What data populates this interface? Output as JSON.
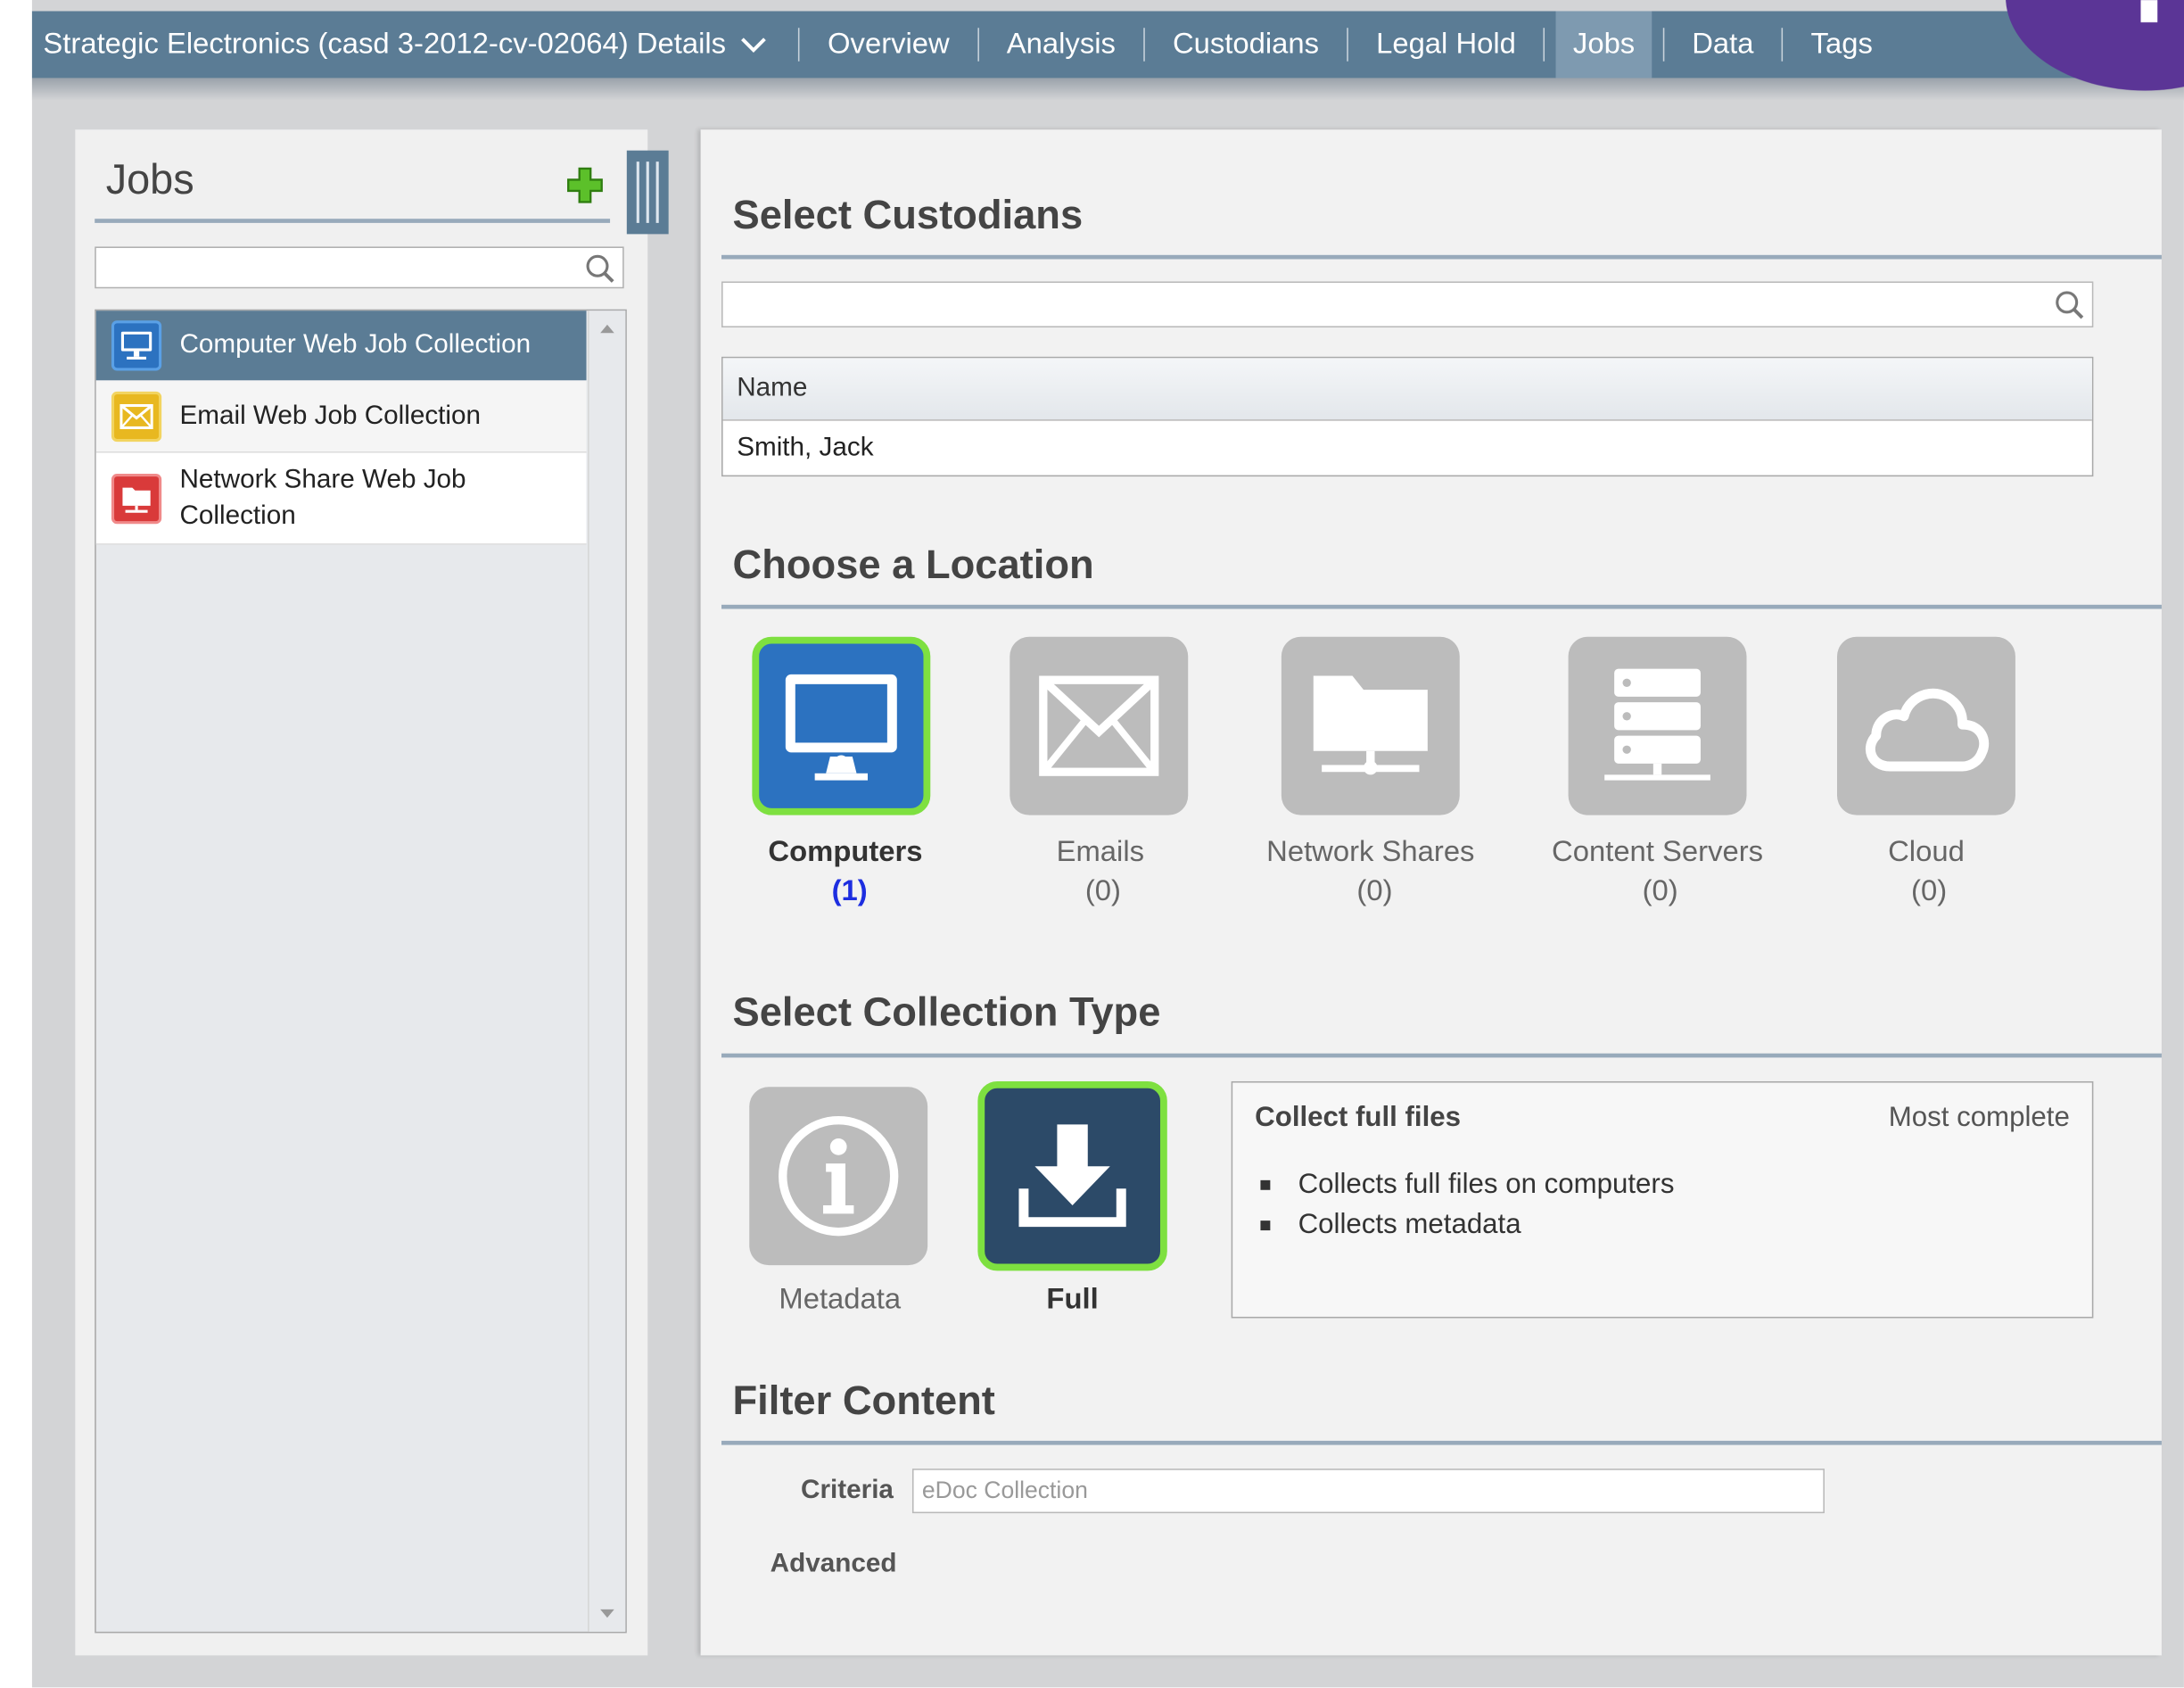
{
  "header": {
    "case_title": "Strategic Electronics (casd 3-2012-cv-02064) Details",
    "tabs": [
      {
        "label": "Overview"
      },
      {
        "label": "Analysis"
      },
      {
        "label": "Custodians"
      },
      {
        "label": "Legal Hold"
      },
      {
        "label": "Jobs",
        "active": true
      },
      {
        "label": "Data"
      },
      {
        "label": "Tags"
      }
    ]
  },
  "jobs_panel": {
    "title": "Jobs",
    "search_value": "",
    "items": [
      {
        "label": "Computer Web Job Collection",
        "icon": "computer-icon",
        "selected": true,
        "color": "#2c72c0"
      },
      {
        "label": "Email Web Job Collection",
        "icon": "envelope-icon",
        "color": "#e8b820"
      },
      {
        "label": "Network Share Web Job Collection",
        "icon": "network-share-icon",
        "color": "#d93a3a"
      }
    ]
  },
  "custodians": {
    "title": "Select Custodians",
    "search_value": "",
    "column_header": "Name",
    "rows": [
      {
        "name": "Smith, Jack"
      }
    ]
  },
  "location": {
    "title": "Choose a Location",
    "options": [
      {
        "label": "Computers",
        "count": "(1)",
        "icon": "monitor-icon",
        "selected": true
      },
      {
        "label": "Emails",
        "count": "(0)",
        "icon": "envelope-icon"
      },
      {
        "label": "Network Shares",
        "count": "(0)",
        "icon": "folder-network-icon"
      },
      {
        "label": "Content Servers",
        "count": "(0)",
        "icon": "server-icon"
      },
      {
        "label": "Cloud",
        "count": "(0)",
        "icon": "cloud-icon"
      }
    ]
  },
  "collection_type": {
    "title": "Select Collection Type",
    "options": [
      {
        "label": "Metadata",
        "icon": "info-icon"
      },
      {
        "label": "Full",
        "icon": "download-icon",
        "selected": true
      }
    ],
    "description": {
      "title": "Collect full files",
      "tag": "Most complete",
      "bullets": [
        "Collects full files on computers",
        "Collects metadata"
      ]
    }
  },
  "filter": {
    "title": "Filter Content",
    "criteria_label": "Criteria",
    "criteria_value": "eDoc Collection",
    "advanced_label": "Advanced"
  },
  "colors": {
    "nav_bar": "#5b7c95",
    "selected_border": "#7ee040",
    "selected_tile": "#2c72c0",
    "link_count": "#1d2ee0",
    "badge": "#5b3596"
  }
}
